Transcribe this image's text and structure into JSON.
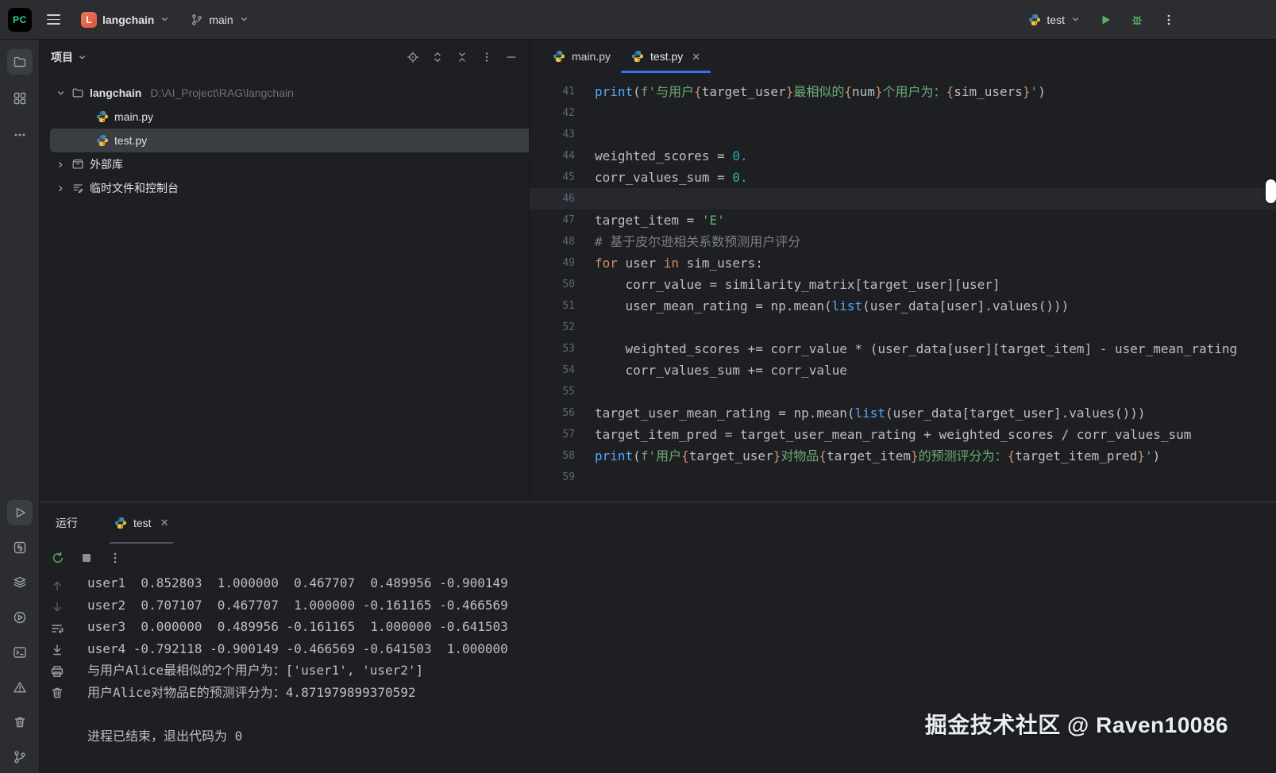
{
  "titlebar": {
    "logo_text": "PC",
    "project": {
      "badge_letter": "L",
      "label": "langchain"
    },
    "branch": {
      "label": "main"
    },
    "run_config": {
      "label": "test"
    }
  },
  "tool_stripe": {
    "top_icons": [
      "project-folder-icon",
      "structure-icon",
      "more-icon"
    ],
    "bottom_icons": [
      "run-icon",
      "python-console-icon",
      "services-icon",
      "run-anything-icon",
      "terminal-icon",
      "problems-icon",
      "delete-icon",
      "git-icon"
    ]
  },
  "project_panel": {
    "title": "项目",
    "header_icons": [
      "locate-icon",
      "expand-all-icon",
      "collapse-all-icon",
      "options-icon",
      "hide-icon"
    ],
    "tree": [
      {
        "label": "langchain",
        "path": "D:\\AI_Project\\RAG\\langchain"
      },
      {
        "label": "main.py"
      },
      {
        "label": "test.py"
      },
      {
        "label": "外部库"
      },
      {
        "label": "临时文件和控制台"
      }
    ]
  },
  "editor": {
    "tabs": [
      {
        "label": "main.py",
        "active": false
      },
      {
        "label": "test.py",
        "active": true
      }
    ],
    "lines": [
      {
        "num": 41,
        "tokens": [
          [
            "f",
            "print"
          ],
          [
            "d",
            "("
          ],
          [
            "s",
            "f'与用户"
          ],
          [
            "b",
            "{"
          ],
          [
            "d",
            "target_user"
          ],
          [
            "b",
            "}"
          ],
          [
            "s",
            "最相似的"
          ],
          [
            "b",
            "{"
          ],
          [
            "d",
            "num"
          ],
          [
            "b",
            "}"
          ],
          [
            "s",
            "个用户为："
          ],
          [
            "b",
            "{"
          ],
          [
            "d",
            "sim_users"
          ],
          [
            "b",
            "}"
          ],
          [
            "s",
            "'"
          ],
          [
            "d",
            ")"
          ]
        ]
      },
      {
        "num": 42,
        "tokens": []
      },
      {
        "num": 43,
        "tokens": []
      },
      {
        "num": 44,
        "tokens": [
          [
            "d",
            "weighted_scores = "
          ],
          [
            "n",
            "0."
          ]
        ]
      },
      {
        "num": 45,
        "tokens": [
          [
            "d",
            "corr_values_sum = "
          ],
          [
            "n",
            "0."
          ]
        ]
      },
      {
        "num": 46,
        "tokens": [],
        "current": true
      },
      {
        "num": 47,
        "tokens": [
          [
            "d",
            "target_item = "
          ],
          [
            "s",
            "'E'"
          ]
        ]
      },
      {
        "num": 48,
        "tokens": [
          [
            "c",
            "# 基于皮尔逊相关系数预测用户评分"
          ]
        ]
      },
      {
        "num": 49,
        "tokens": [
          [
            "k",
            "for"
          ],
          [
            "d",
            " user "
          ],
          [
            "k",
            "in"
          ],
          [
            "d",
            " sim_users:"
          ]
        ]
      },
      {
        "num": 50,
        "tokens": [
          [
            "d",
            "    corr_value = similarity_matrix[target_user][user]"
          ]
        ]
      },
      {
        "num": 51,
        "tokens": [
          [
            "d",
            "    user_mean_rating = np.mean("
          ],
          [
            "f",
            "list"
          ],
          [
            "d",
            "(user_data[user].values()))"
          ]
        ]
      },
      {
        "num": 52,
        "tokens": []
      },
      {
        "num": 53,
        "tokens": [
          [
            "d",
            "    weighted_scores += corr_value * (user_data[user][target_item] - user_mean_rating"
          ]
        ]
      },
      {
        "num": 54,
        "tokens": [
          [
            "d",
            "    corr_values_sum += corr_value"
          ]
        ]
      },
      {
        "num": 55,
        "tokens": []
      },
      {
        "num": 56,
        "tokens": [
          [
            "d",
            "target_user_mean_rating = np.mean("
          ],
          [
            "f",
            "list"
          ],
          [
            "d",
            "(user_data[target_user].values()))"
          ]
        ]
      },
      {
        "num": 57,
        "tokens": [
          [
            "d",
            "target_item_pred = target_user_mean_rating + weighted_scores / corr_values_sum"
          ]
        ]
      },
      {
        "num": 58,
        "tokens": [
          [
            "f",
            "print"
          ],
          [
            "d",
            "("
          ],
          [
            "s",
            "f'用户"
          ],
          [
            "b",
            "{"
          ],
          [
            "d",
            "target_user"
          ],
          [
            "b",
            "}"
          ],
          [
            "s",
            "对物品"
          ],
          [
            "b",
            "{"
          ],
          [
            "d",
            "target_item"
          ],
          [
            "b",
            "}"
          ],
          [
            "s",
            "的预测评分为："
          ],
          [
            "b",
            "{"
          ],
          [
            "d",
            "target_item_pred"
          ],
          [
            "b",
            "}"
          ],
          [
            "s",
            "'"
          ],
          [
            "d",
            ")"
          ]
        ]
      },
      {
        "num": 59,
        "tokens": []
      }
    ]
  },
  "run_panel": {
    "title": "运行",
    "tab_label": "test",
    "toolbar_icons": [
      "rerun-icon",
      "stop-icon",
      "options-icon"
    ],
    "gutter_icons": [
      "up-icon",
      "down-icon",
      "soft-wrap-icon",
      "scroll-to-end-icon",
      "print-icon",
      "clear-icon"
    ],
    "console": [
      "user1  0.852803  1.000000  0.467707  0.489956 -0.900149",
      "user2  0.707107  0.467707  1.000000 -0.161165 -0.466569",
      "user3  0.000000  0.489956 -0.161165  1.000000 -0.641503",
      "user4 -0.792118 -0.900149 -0.466569 -0.641503  1.000000",
      "与用户Alice最相似的2个用户为：['user1', 'user2']",
      "用户Alice对物品E的预测评分为：4.871979899370592",
      "",
      "进程已结束，退出代码为 0"
    ]
  },
  "colors": {
    "accent": "#3574f0",
    "run_green": "#5fad65",
    "keyword": "#cf8e6d",
    "string": "#6aab73",
    "number": "#2aacb8",
    "builtin": "#56a8f5",
    "comment": "#7a7e85",
    "editor_bg": "#1e1f22",
    "panel_bg": "#2b2d30",
    "selection_bg": "#3a3d41"
  },
  "watermark": "掘金技术社区 @ Raven10086"
}
